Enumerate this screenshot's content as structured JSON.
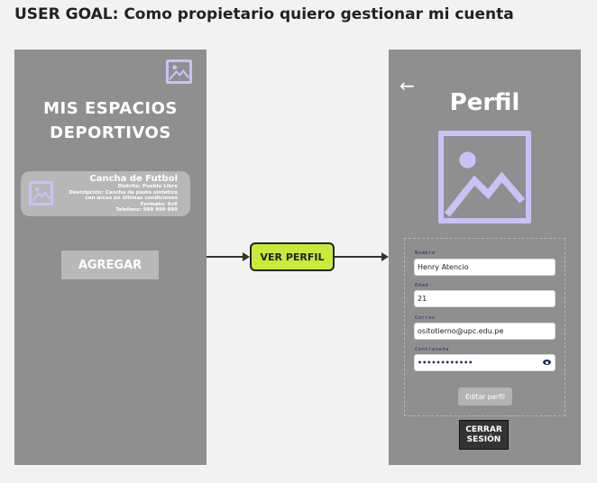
{
  "goal": "USER GOAL: Como propietario quiero gestionar mi cuenta",
  "home": {
    "title_line1": "MIS ESPACIOS",
    "title_line2": "DEPORTIVOS",
    "card": {
      "title": "Cancha de Futbol",
      "lines": [
        "Distrito: Pueblo Libre",
        "Descripción: Cancha de pasto sintetico",
        "con arcos en óltimas condiciones",
        "Formato: 6v6",
        "Telefono: 999 999 999"
      ]
    },
    "add_button": "AGREGAR"
  },
  "flow_button": "VER PERFIL",
  "profile": {
    "back_symbol": "←",
    "title": "Perfil",
    "fields": {
      "name_label": "Nombre",
      "name_value": "Henry Atencio",
      "age_label": "Edad",
      "age_value": "21",
      "email_label": "Correo",
      "email_value": "ositotierno@upc.edu.pe",
      "password_label": "Contraseña",
      "password_value": "••••••••••••"
    },
    "edit_button": "Editar perfil",
    "logout_button": "CERRAR\nSESIÓN"
  },
  "colors": {
    "accent_lime": "#c8ea3a",
    "icon_lavender": "#c9c2f5",
    "screen_gray": "#8f8f8f"
  }
}
